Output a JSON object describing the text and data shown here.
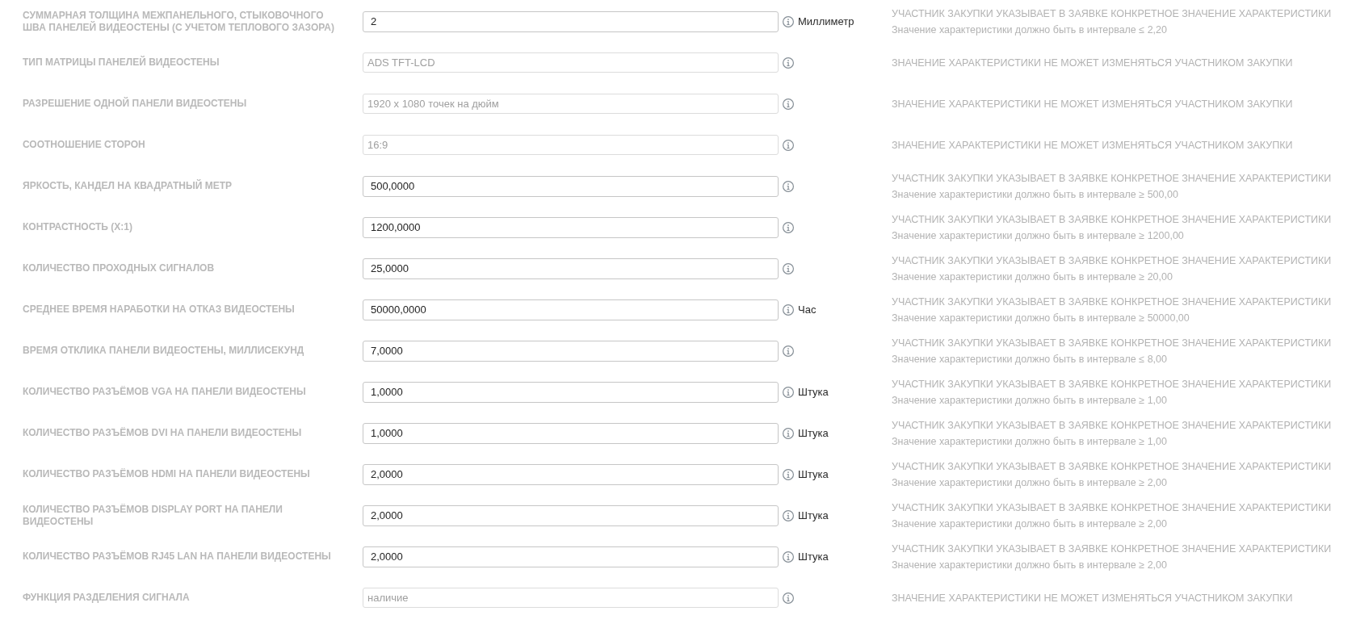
{
  "rows": [
    {
      "label": "СУММАРНАЯ ТОЛЩИНА МЕЖПАНЕЛЬНОГО, СТЫКОВОЧНОГО ШВА ПАНЕЛЕЙ ВИДЕОСТЕНЫ (С УЧЕТОМ ТЕПЛОВОГО ЗАЗОРА)",
      "value": "2",
      "disabled": false,
      "unit": "Миллиметр",
      "note": {
        "title": "УЧАСТНИК ЗАКУПКИ УКАЗЫВАЕТ В ЗАЯВКЕ КОНКРЕТНОЕ ЗНАЧЕНИЕ ХАРАКТЕРИСТИКИ",
        "detail": "Значение характеристики должно быть в интервале ≤ 2,20"
      }
    },
    {
      "label": "ТИП МАТРИЦЫ ПАНЕЛЕЙ ВИДЕОСТЕНЫ",
      "value": "ADS TFT-LCD",
      "disabled": true,
      "note": {
        "title": "ЗНАЧЕНИЕ ХАРАКТЕРИСТИКИ НЕ МОЖЕТ ИЗМЕНЯТЬСЯ УЧАСТНИКОМ ЗАКУПКИ"
      }
    },
    {
      "label": "РАЗРЕШЕНИЕ ОДНОЙ ПАНЕЛИ ВИДЕОСТЕНЫ",
      "value": "1920 x 1080 точек на дюйм",
      "disabled": true,
      "note": {
        "title": "ЗНАЧЕНИЕ ХАРАКТЕРИСТИКИ НЕ МОЖЕТ ИЗМЕНЯТЬСЯ УЧАСТНИКОМ ЗАКУПКИ"
      }
    },
    {
      "label": "СООТНОШЕНИЕ СТОРОН",
      "value": "16:9",
      "disabled": true,
      "note": {
        "title": "ЗНАЧЕНИЕ ХАРАКТЕРИСТИКИ НЕ МОЖЕТ ИЗМЕНЯТЬСЯ УЧАСТНИКОМ ЗАКУПКИ"
      }
    },
    {
      "label": "ЯРКОСТЬ, КАНДЕЛ НА КВАДРАТНЫЙ МЕТР",
      "value": "500,0000",
      "disabled": false,
      "note": {
        "title": "УЧАСТНИК ЗАКУПКИ УКАЗЫВАЕТ В ЗАЯВКЕ КОНКРЕТНОЕ ЗНАЧЕНИЕ ХАРАКТЕРИСТИКИ",
        "detail": "Значение характеристики должно быть в интервале ≥ 500,00"
      }
    },
    {
      "label": "КОНТРАСТНОСТЬ (X:1)",
      "value": "1200,0000",
      "disabled": false,
      "note": {
        "title": "УЧАСТНИК ЗАКУПКИ УКАЗЫВАЕТ В ЗАЯВКЕ КОНКРЕТНОЕ ЗНАЧЕНИЕ ХАРАКТЕРИСТИКИ",
        "detail": "Значение характеристики должно быть в интервале ≥ 1200,00"
      }
    },
    {
      "label": "КОЛИЧЕСТВО ПРОХОДНЫХ СИГНАЛОВ",
      "value": "25,0000",
      "disabled": false,
      "note": {
        "title": "УЧАСТНИК ЗАКУПКИ УКАЗЫВАЕТ В ЗАЯВКЕ КОНКРЕТНОЕ ЗНАЧЕНИЕ ХАРАКТЕРИСТИКИ",
        "detail": "Значение характеристики должно быть в интервале ≥ 20,00"
      }
    },
    {
      "label": "СРЕДНЕЕ ВРЕМЯ НАРАБОТКИ НА ОТКАЗ ВИДЕОСТЕНЫ",
      "value": "50000,0000",
      "disabled": false,
      "unit": "Час",
      "note": {
        "title": "УЧАСТНИК ЗАКУПКИ УКАЗЫВАЕТ В ЗАЯВКЕ КОНКРЕТНОЕ ЗНАЧЕНИЕ ХАРАКТЕРИСТИКИ",
        "detail": "Значение характеристики должно быть в интервале ≥ 50000,00"
      }
    },
    {
      "label": "ВРЕМЯ ОТКЛИКА ПАНЕЛИ ВИДЕОСТЕНЫ, МИЛЛИСЕКУНД",
      "value": "7,0000",
      "disabled": false,
      "note": {
        "title": "УЧАСТНИК ЗАКУПКИ УКАЗЫВАЕТ В ЗАЯВКЕ КОНКРЕТНОЕ ЗНАЧЕНИЕ ХАРАКТЕРИСТИКИ",
        "detail": "Значение характеристики должно быть в интервале ≤ 8,00"
      }
    },
    {
      "label": "КОЛИЧЕСТВО РАЗЪЁМОВ VGA НА ПАНЕЛИ ВИДЕОСТЕНЫ",
      "value": "1,0000",
      "disabled": false,
      "unit": "Штука",
      "note": {
        "title": "УЧАСТНИК ЗАКУПКИ УКАЗЫВАЕТ В ЗАЯВКЕ КОНКРЕТНОЕ ЗНАЧЕНИЕ ХАРАКТЕРИСТИКИ",
        "detail": "Значение характеристики должно быть в интервале ≥ 1,00"
      }
    },
    {
      "label": "КОЛИЧЕСТВО РАЗЪЁМОВ DVI НА ПАНЕЛИ ВИДЕОСТЕНЫ",
      "value": "1,0000",
      "disabled": false,
      "unit": "Штука",
      "note": {
        "title": "УЧАСТНИК ЗАКУПКИ УКАЗЫВАЕТ В ЗАЯВКЕ КОНКРЕТНОЕ ЗНАЧЕНИЕ ХАРАКТЕРИСТИКИ",
        "detail": "Значение характеристики должно быть в интервале ≥ 1,00"
      }
    },
    {
      "label": "КОЛИЧЕСТВО РАЗЪЁМОВ HDMI НА ПАНЕЛИ ВИДЕОСТЕНЫ",
      "value": "2,0000",
      "disabled": false,
      "unit": "Штука",
      "note": {
        "title": "УЧАСТНИК ЗАКУПКИ УКАЗЫВАЕТ В ЗАЯВКЕ КОНКРЕТНОЕ ЗНАЧЕНИЕ ХАРАКТЕРИСТИКИ",
        "detail": "Значение характеристики должно быть в интервале ≥ 2,00"
      }
    },
    {
      "label": "КОЛИЧЕСТВО РАЗЪЁМОВ DISPLAY PORT НА ПАНЕЛИ ВИДЕОСТЕНЫ",
      "value": "2,0000",
      "disabled": false,
      "unit": "Штука",
      "note": {
        "title": "УЧАСТНИК ЗАКУПКИ УКАЗЫВАЕТ В ЗАЯВКЕ КОНКРЕТНОЕ ЗНАЧЕНИЕ ХАРАКТЕРИСТИКИ",
        "detail": "Значение характеристики должно быть в интервале ≥ 2,00"
      }
    },
    {
      "label": "КОЛИЧЕСТВО РАЗЪЁМОВ RJ45 LAN НА ПАНЕЛИ ВИДЕОСТЕНЫ",
      "value": "2,0000",
      "disabled": false,
      "unit": "Штука",
      "note": {
        "title": "УЧАСТНИК ЗАКУПКИ УКАЗЫВАЕТ В ЗАЯВКЕ КОНКРЕТНОЕ ЗНАЧЕНИЕ ХАРАКТЕРИСТИКИ",
        "detail": "Значение характеристики должно быть в интервале ≥ 2,00"
      }
    },
    {
      "label": "ФУНКЦИЯ РАЗДЕЛЕНИЯ СИГНАЛА",
      "value": "наличие",
      "disabled": true,
      "note": {
        "title": "ЗНАЧЕНИЕ ХАРАКТЕРИСТИКИ НЕ МОЖЕТ ИЗМЕНЯТЬСЯ УЧАСТНИКОМ ЗАКУПКИ"
      }
    }
  ]
}
